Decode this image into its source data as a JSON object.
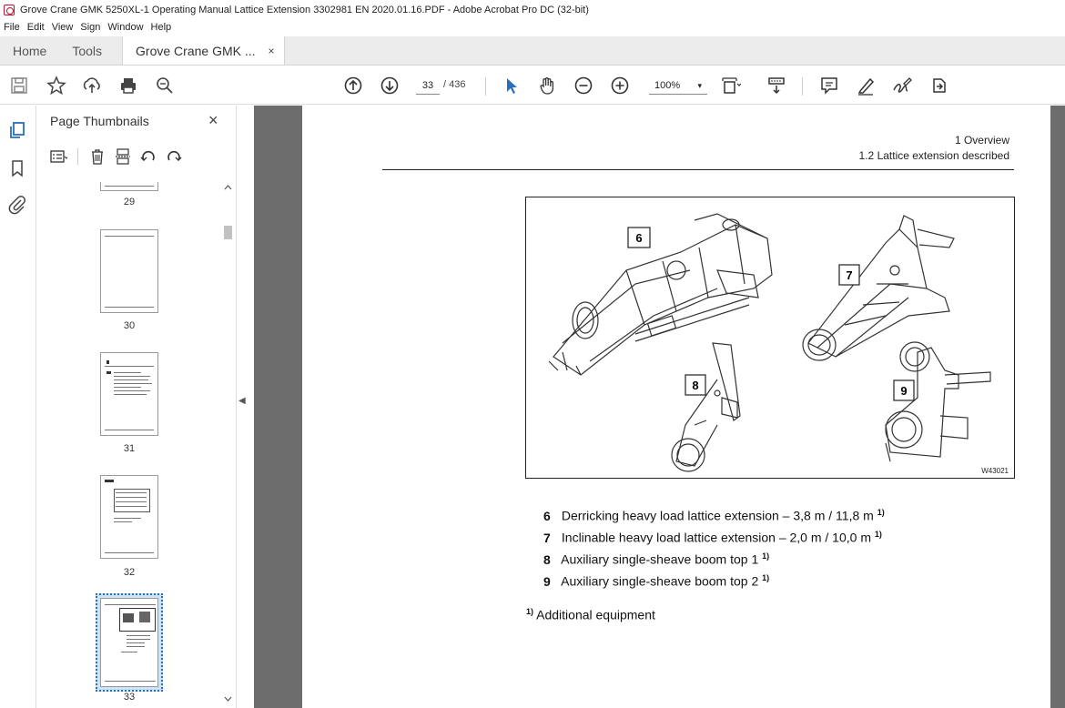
{
  "window": {
    "title": "Grove Crane GMK 5250XL-1 Operating Manual Lattice Extension 3302981 EN 2020.01.16.PDF - Adobe Acrobat Pro DC (32-bit)"
  },
  "menu": [
    "File",
    "Edit",
    "View",
    "Sign",
    "Window",
    "Help"
  ],
  "tabs": {
    "home": "Home",
    "tools": "Tools",
    "document": "Grove Crane GMK ...",
    "close": "×"
  },
  "toolbar": {
    "page_current": "33",
    "page_total": "/ 436",
    "zoom": "100%",
    "zoom_caret": "▾",
    "icons": [
      "save-icon",
      "bookmark-star-icon",
      "upload-icon",
      "print-icon",
      "zoom-search-icon",
      "prev-page-icon",
      "next-page-icon",
      "select-arrow-icon",
      "hand-icon",
      "zoom-out-icon",
      "zoom-in-icon",
      "fit-page-icon",
      "scroll-mode-icon",
      "comment-icon",
      "highlight-icon",
      "sign-icon",
      "share-icon"
    ]
  },
  "sidebar": {
    "title": "Page Thumbnails",
    "close": "×",
    "thumbnails": [
      {
        "label": "29"
      },
      {
        "label": "30"
      },
      {
        "label": "31"
      },
      {
        "label": "32"
      },
      {
        "label": "33",
        "selected": true
      }
    ]
  },
  "document": {
    "header_line1": "1 Overview",
    "header_line2": "1.2 Lattice extension described",
    "figure": {
      "callouts": [
        "6",
        "7",
        "8",
        "9"
      ],
      "id": "W43021"
    },
    "items": [
      {
        "num": "6",
        "text": "Derricking heavy load lattice extension – 3,8 m / 11,8 m",
        "sup": "1)"
      },
      {
        "num": "7",
        "text": "Inclinable heavy load lattice extension – 2,0 m / 10,0 m",
        "sup": "1)"
      },
      {
        "num": "8",
        "text": "Auxiliary single-sheave boom top 1",
        "sup": "1)"
      },
      {
        "num": "9",
        "text": "Auxiliary single-sheave boom top 2",
        "sup": "1)"
      }
    ],
    "footnote_mark": "1)",
    "footnote_text": "Additional equipment"
  },
  "colors": {
    "accent": "#2a6ebb",
    "viewport_bg": "#6d6d6d",
    "tab_bg": "#ececec"
  }
}
